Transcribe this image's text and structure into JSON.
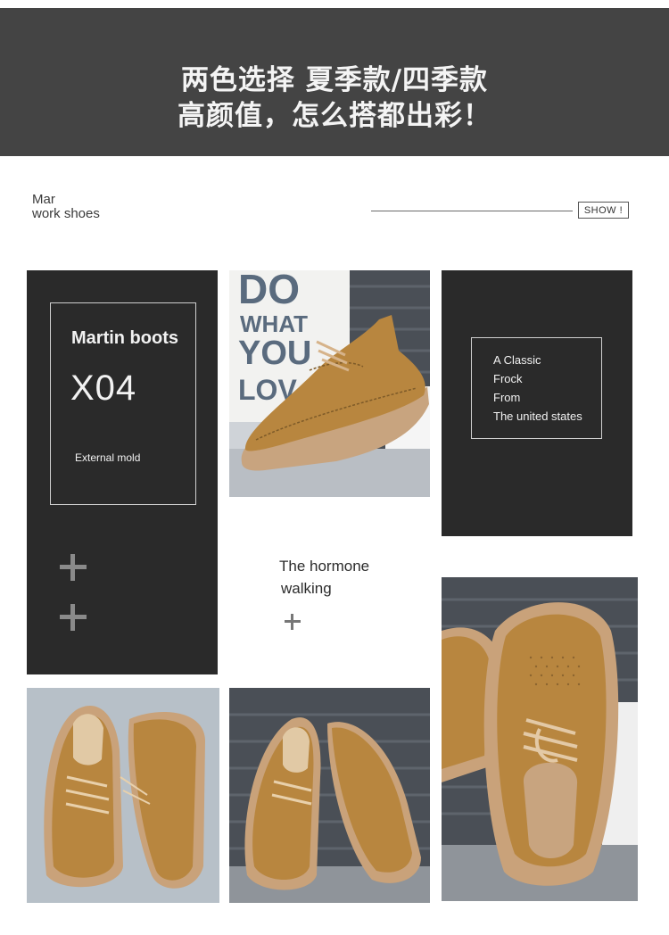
{
  "header": {
    "line1": "两色选择 夏季款/四季款",
    "line2": "高颜值，怎么搭都出彩！"
  },
  "brand": {
    "line1": "Mar",
    "line2": "work shoes",
    "show_label": "SHOW !"
  },
  "left_panel": {
    "title": "Martin boots",
    "code": "X04",
    "subtitle": "External mold"
  },
  "right_panel": {
    "lines": [
      "A Classic",
      "Frock",
      "From",
      "The united states"
    ]
  },
  "center_caption": {
    "line1": "The hormone",
    "line2": "walking"
  },
  "poster_text": {
    "line1": "DO",
    "line2": "WHAT",
    "line3": "YOU",
    "line4": "LOV"
  },
  "colors": {
    "header_bg": "#444444",
    "panel_bg": "#2a2a2a",
    "shoe_tan": "#b8863f",
    "sole": "#c9a27a"
  }
}
